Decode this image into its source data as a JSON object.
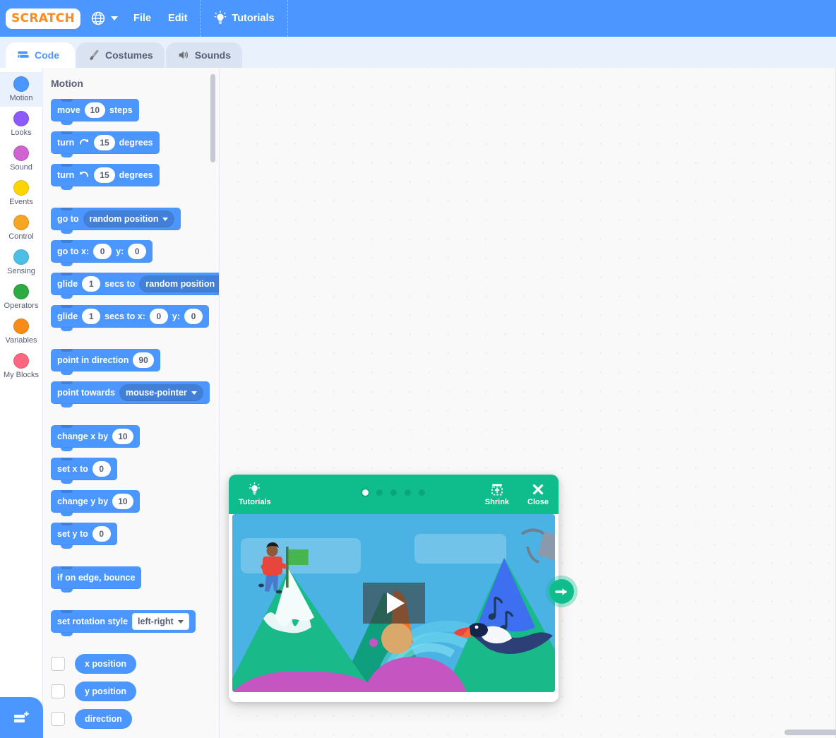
{
  "menubar": {
    "logo_text": "SCRATCH",
    "logo_icon": "scratch-logo",
    "globe_icon": "globe-icon",
    "chevron_icon": "chevron-down-icon",
    "file_label": "File",
    "edit_label": "Edit",
    "tutorials_label": "Tutorials",
    "bulb_icon": "lightbulb-icon",
    "accent_color": "#4c97ff"
  },
  "tabs": [
    {
      "label": "Code",
      "icon": "code-blocks-icon",
      "active": true
    },
    {
      "label": "Costumes",
      "icon": "paintbrush-icon",
      "active": false
    },
    {
      "label": "Sounds",
      "icon": "speaker-icon",
      "active": false
    }
  ],
  "categories": [
    {
      "label": "Motion",
      "color": "#4c97ff",
      "selected": true
    },
    {
      "label": "Looks",
      "color": "#8c5bf9",
      "selected": false
    },
    {
      "label": "Sound",
      "color": "#cf63cf",
      "selected": false
    },
    {
      "label": "Events",
      "color": "#ffd500",
      "selected": false
    },
    {
      "label": "Control",
      "color": "#f5a623",
      "selected": false
    },
    {
      "label": "Sensing",
      "color": "#4cbfe6",
      "selected": false
    },
    {
      "label": "Operators",
      "color": "#2eaa42",
      "selected": false
    },
    {
      "label": "Variables",
      "color": "#f78c18",
      "selected": false
    },
    {
      "label": "My Blocks",
      "color": "#fc6680",
      "selected": false
    }
  ],
  "extension_button": {
    "icon": "add-extension-icon",
    "label": "Add Extension"
  },
  "palette": {
    "heading": "Motion",
    "blocks": {
      "move": {
        "pre": "move",
        "value": "10",
        "post": "steps"
      },
      "turn_cw": {
        "pre": "turn",
        "icon": "turn-clockwise-icon",
        "value": "15",
        "post": "degrees"
      },
      "turn_ccw": {
        "pre": "turn",
        "icon": "turn-counterclockwise-icon",
        "value": "15",
        "post": "degrees"
      },
      "go_to": {
        "pre": "go to",
        "option": "random position"
      },
      "go_to_xy": {
        "pre": "go to x:",
        "x": "0",
        "mid": "y:",
        "y": "0"
      },
      "glide_to": {
        "pre": "glide",
        "secs": "1",
        "mid": "secs to",
        "option": "random position"
      },
      "glide_xy": {
        "pre": "glide",
        "secs": "1",
        "mid": "secs to x:",
        "x": "0",
        "mid2": "y:",
        "y": "0"
      },
      "point_direction": {
        "pre": "point in direction",
        "value": "90"
      },
      "point_towards": {
        "pre": "point towards",
        "option": "mouse-pointer"
      },
      "change_x": {
        "pre": "change x by",
        "value": "10"
      },
      "set_x": {
        "pre": "set x to",
        "value": "0"
      },
      "change_y": {
        "pre": "change y by",
        "value": "10"
      },
      "set_y": {
        "pre": "set y to",
        "value": "0"
      },
      "bounce": {
        "pre": "if on edge, bounce"
      },
      "rotation_style": {
        "pre": "set rotation style",
        "option": "left-right"
      }
    },
    "reporters": [
      {
        "label": "x position",
        "checked": false
      },
      {
        "label": "y position",
        "checked": false
      },
      {
        "label": "direction",
        "checked": false
      }
    ]
  },
  "tutorial_card": {
    "header": {
      "title": "Tutorials",
      "bulb_icon": "lightbulb-icon",
      "shrink_label": "Shrink",
      "shrink_icon": "shrink-icon",
      "close_label": "Close",
      "close_icon": "close-icon",
      "dots": [
        true,
        false,
        false,
        false,
        false
      ],
      "color": "#0fbd8c"
    },
    "thumbnail": {
      "play_icon": "play-button-icon",
      "alt": "Scratch tutorial video thumbnail with mountains, flag, toucan and paint bucket"
    },
    "next_icon": "arrow-right-icon"
  }
}
